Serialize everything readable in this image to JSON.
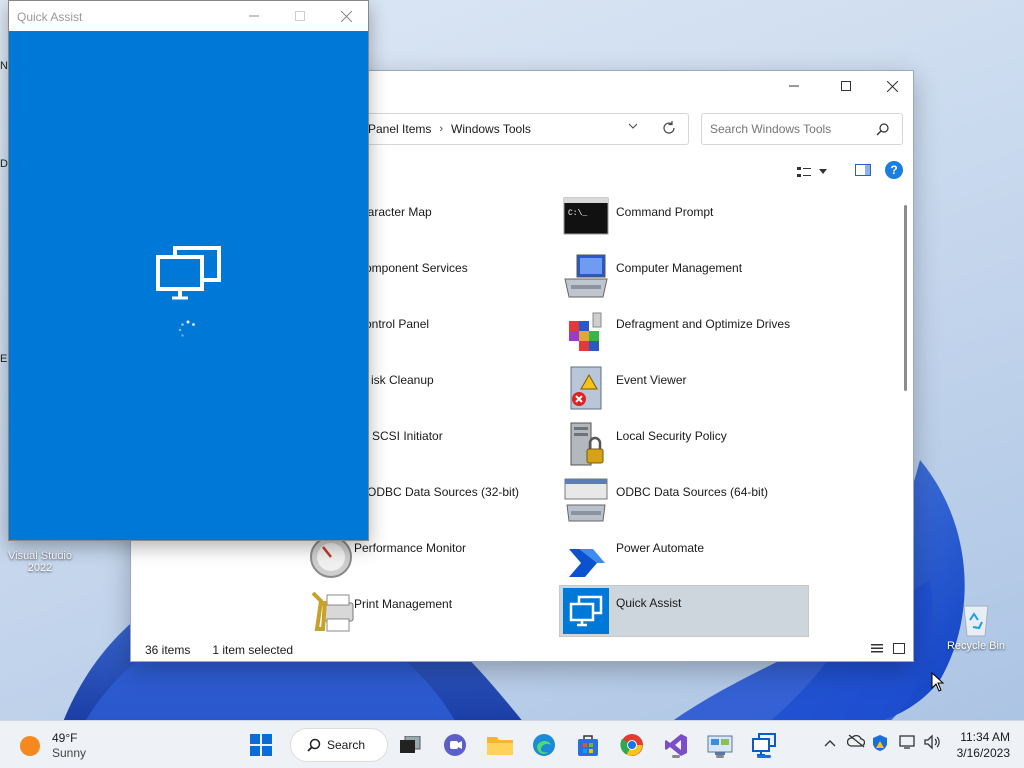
{
  "desktop": {
    "icons": [
      {
        "label": "Visual Studio 2022",
        "icon": "visual-studio-icon"
      },
      {
        "label": "Recycle Bin",
        "icon": "recycle-bin-icon"
      }
    ],
    "edge_labels": [
      "N",
      "D",
      "E"
    ]
  },
  "quick_assist": {
    "title": "Quick Assist",
    "state": "loading"
  },
  "explorer": {
    "breadcrumb": [
      "l Panel Items",
      "Windows Tools"
    ],
    "search_placeholder": "Search Windows Tools",
    "items": [
      {
        "label": "Character Map",
        "icon": "character-map-icon"
      },
      {
        "label": "Command Prompt",
        "icon": "command-prompt-icon"
      },
      {
        "label": "Component Services",
        "icon": "component-services-icon"
      },
      {
        "label": "Computer Management",
        "icon": "computer-management-icon"
      },
      {
        "label": "Control Panel",
        "icon": "control-panel-icon"
      },
      {
        "label": "Defragment and Optimize Drives",
        "icon": "defrag-icon"
      },
      {
        "label": "Disk Cleanup",
        "icon": "disk-cleanup-icon"
      },
      {
        "label": "Event Viewer",
        "icon": "event-viewer-icon"
      },
      {
        "label": "iSCSI Initiator",
        "icon": "iscsi-icon"
      },
      {
        "label": "Local Security Policy",
        "icon": "security-policy-icon"
      },
      {
        "label": "ODBC Data Sources (32-bit)",
        "icon": "odbc-icon"
      },
      {
        "label": "ODBC Data Sources (64-bit)",
        "icon": "odbc-icon"
      },
      {
        "label": "Performance Monitor",
        "icon": "performance-monitor-icon"
      },
      {
        "label": "Power Automate",
        "icon": "power-automate-icon"
      },
      {
        "label": "Print Management",
        "icon": "print-management-icon"
      },
      {
        "label": "Quick Assist",
        "icon": "quick-assist-icon",
        "selected": true
      }
    ],
    "visible_labels": [
      "haracter Map",
      "Command Prompt",
      "omponent Services",
      "Computer Management",
      "ontrol Panel",
      "Defragment and Optimize Drives",
      "isk Cleanup",
      "Event Viewer",
      "SCSI Initiator",
      "Local Security Policy",
      "ODBC Data Sources (32-bit)",
      "ODBC Data Sources (64-bit)",
      "Performance Monitor",
      "Power Automate",
      "Print Management",
      "Quick Assist"
    ],
    "status": {
      "count": "36 items",
      "selection": "1 item selected"
    }
  },
  "taskbar": {
    "weather": {
      "temp": "49°F",
      "condition": "Sunny"
    },
    "search_label": "Search",
    "pinned": [
      "start-icon",
      "task-view-icon",
      "chat-icon",
      "file-explorer-icon",
      "edge-icon",
      "store-icon",
      "chrome-icon",
      "visual-studio-icon",
      "control-panel-icon",
      "quick-assist-icon"
    ],
    "clock": {
      "time": "11:34 AM",
      "date": "3/16/2023"
    }
  },
  "colors": {
    "quick_assist_blue": "#0078d7",
    "selection": "#cdd5dd"
  }
}
